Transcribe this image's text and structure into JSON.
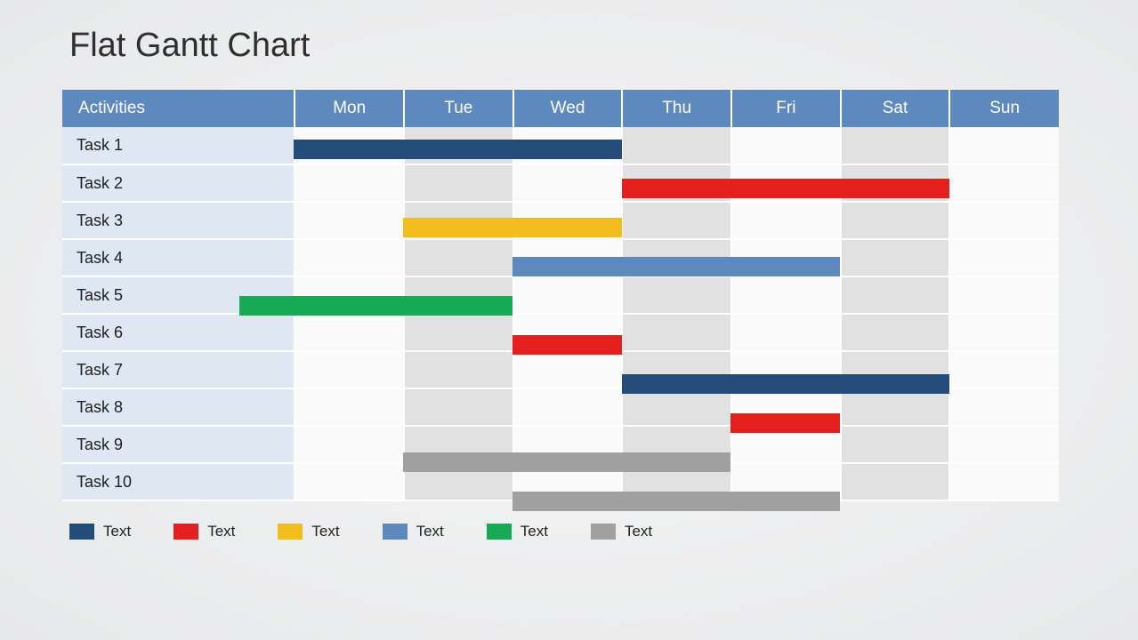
{
  "title": "Flat Gantt Chart",
  "header": {
    "activities": "Activities",
    "days": [
      "Mon",
      "Tue",
      "Wed",
      "Thu",
      "Fri",
      "Sat",
      "Sun"
    ]
  },
  "tasks": [
    {
      "name": "Task 1"
    },
    {
      "name": "Task 2"
    },
    {
      "name": "Task 3"
    },
    {
      "name": "Task 4"
    },
    {
      "name": "Task 5"
    },
    {
      "name": "Task 6"
    },
    {
      "name": "Task 7"
    },
    {
      "name": "Task 8"
    },
    {
      "name": "Task 9"
    },
    {
      "name": "Task 10"
    }
  ],
  "colors": {
    "navy": "#244c7b",
    "red": "#e3201e",
    "yellow": "#f3bd1e",
    "blue": "#5e89bf",
    "green": "#18a955",
    "grey": "#a0a0a0"
  },
  "legend": [
    {
      "color": "navy",
      "label": "Text"
    },
    {
      "color": "red",
      "label": "Text"
    },
    {
      "color": "yellow",
      "label": "Text"
    },
    {
      "color": "blue",
      "label": "Text"
    },
    {
      "color": "green",
      "label": "Text"
    },
    {
      "color": "grey",
      "label": "Text"
    }
  ],
  "chart_data": {
    "type": "bar",
    "title": "Flat Gantt Chart",
    "xlabel": "",
    "ylabel": "",
    "categories": [
      "Mon",
      "Tue",
      "Wed",
      "Thu",
      "Fri",
      "Sat",
      "Sun"
    ],
    "series": [
      {
        "name": "Task 1",
        "start": 0.0,
        "end": 3.0,
        "color": "navy"
      },
      {
        "name": "Task 2",
        "start": 3.0,
        "end": 6.0,
        "color": "red"
      },
      {
        "name": "Task 3",
        "start": 1.0,
        "end": 3.0,
        "color": "yellow"
      },
      {
        "name": "Task 4",
        "start": 2.0,
        "end": 5.0,
        "color": "blue"
      },
      {
        "name": "Task 5",
        "start": -0.5,
        "end": 2.0,
        "color": "green"
      },
      {
        "name": "Task 6",
        "start": 2.0,
        "end": 3.0,
        "color": "red"
      },
      {
        "name": "Task 7",
        "start": 3.0,
        "end": 6.0,
        "color": "navy"
      },
      {
        "name": "Task 8",
        "start": 4.0,
        "end": 5.0,
        "color": "red"
      },
      {
        "name": "Task 9",
        "start": 1.0,
        "end": 4.0,
        "color": "grey"
      },
      {
        "name": "Task 10",
        "start": 2.0,
        "end": 5.0,
        "color": "grey"
      }
    ],
    "xlim": [
      0,
      7
    ]
  }
}
